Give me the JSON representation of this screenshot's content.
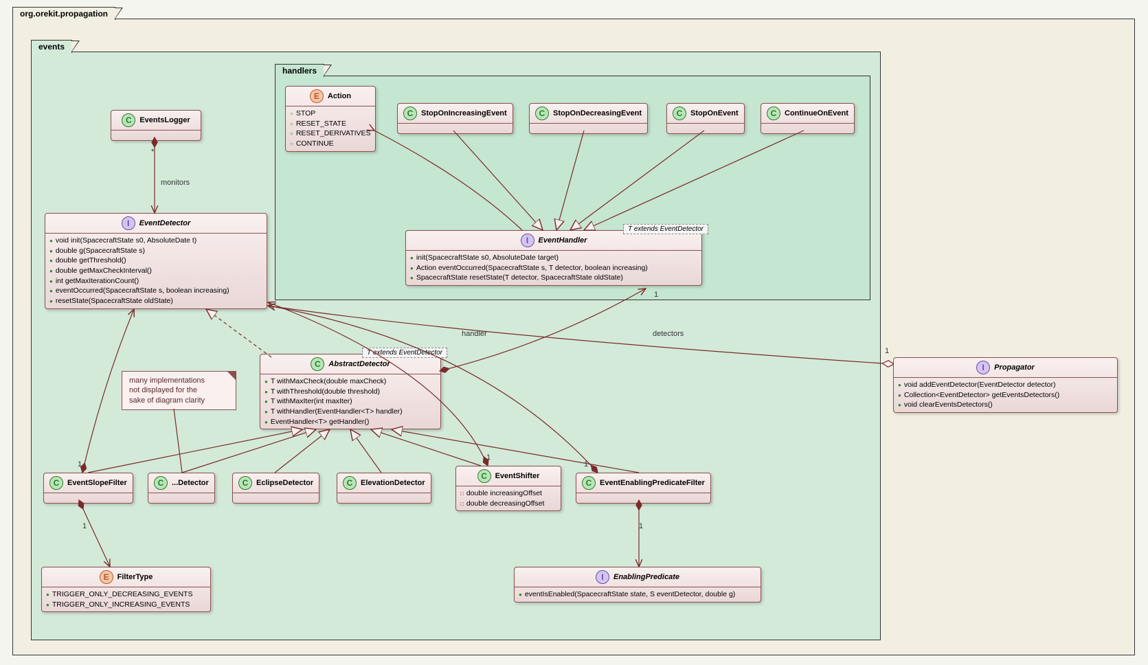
{
  "packages": {
    "root": "org.orekit.propagation",
    "events": "events",
    "handlers": "handlers"
  },
  "classes": {
    "eventsLogger": {
      "name": "EventsLogger"
    },
    "eventDetector": {
      "name": "EventDetector",
      "methods": [
        "void init(SpacecraftState s0, AbsoluteDate t)",
        "double g(SpacecraftState s)",
        "double getThreshold()",
        "double getMaxCheckInterval()",
        "int getMaxIterationCount()",
        "eventOccurred(SpacecraftState s, boolean increasing)",
        "resetState(SpacecraftState oldState)"
      ]
    },
    "action": {
      "name": "Action",
      "values": [
        "STOP",
        "RESET_STATE",
        "RESET_DERIVATIVES",
        "CONTINUE"
      ]
    },
    "stopOnIncreasingEvent": {
      "name": "StopOnIncreasingEvent"
    },
    "stopOnDecreasingEvent": {
      "name": "StopOnDecreasingEvent"
    },
    "stopOnEvent": {
      "name": "StopOnEvent"
    },
    "continueOnEvent": {
      "name": "ContinueOnEvent"
    },
    "eventHandler": {
      "name": "EventHandler",
      "template": "T extends EventDetector",
      "methods": [
        "init(SpacecraftState s0, AbsoluteDate target)",
        "Action eventOccurred(SpacecraftState s, T detector, boolean increasing)",
        "SpacecraftState resetState(T detector, SpacecraftState oldState)"
      ]
    },
    "abstractDetector": {
      "name": "AbstractDetector",
      "template": "T extends EventDetector",
      "methods": [
        "T withMaxCheck(double maxCheck)",
        "T withThreshold(double threshold)",
        "T withMaxIter(int maxIter)",
        "T withHandler(EventHandler<T> handler)",
        "EventHandler<T> getHandler()"
      ]
    },
    "eventSlopeFilter": {
      "name": "EventSlopeFilter"
    },
    "dotDetector": {
      "name": "...Detector"
    },
    "eclipseDetector": {
      "name": "EclipseDetector"
    },
    "elevationDetector": {
      "name": "ElevationDetector"
    },
    "eventShifter": {
      "name": "EventShifter",
      "fields": [
        "double increasingOffset",
        "double decreasingOffset"
      ]
    },
    "eventEnablingPredicateFilter": {
      "name": "EventEnablingPredicateFilter"
    },
    "filterType": {
      "name": "FilterType",
      "values": [
        "TRIGGER_ONLY_DECREASING_EVENTS",
        "TRIGGER_ONLY_INCREASING_EVENTS"
      ]
    },
    "enablingPredicate": {
      "name": "EnablingPredicate",
      "methods": [
        "eventIsEnabled(SpacecraftState state, S eventDetector, double g)"
      ]
    },
    "propagator": {
      "name": "Propagator",
      "methods": [
        "void addEventDetector(EventDetector detector)",
        "Collection<EventDetector> getEventsDetectors()",
        "void clearEventsDetectors()"
      ]
    }
  },
  "note": {
    "line1": "many implementations",
    "line2": "not displayed for the",
    "line3": "sake of diagram clarity"
  },
  "labels": {
    "monitors": "monitors",
    "handler": "handler",
    "detectors": "detectors",
    "star": "*",
    "one": "1"
  }
}
